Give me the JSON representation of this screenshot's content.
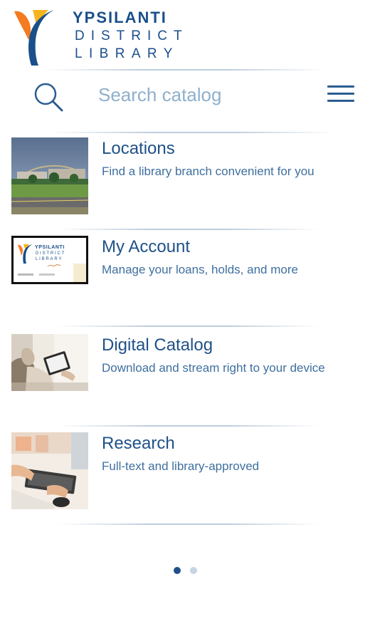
{
  "header": {
    "logo": {
      "line1": "YPSILANTI",
      "line2": "DISTRICT",
      "line3": "LIBRARY"
    }
  },
  "search": {
    "placeholder": "Search catalog"
  },
  "items": [
    {
      "title": "Locations",
      "subtitle": "Find a library branch convenient for you",
      "thumb_icon": "building-photo"
    },
    {
      "title": "My Account",
      "subtitle": "Manage your loans, holds, and more",
      "thumb_icon": "library-card"
    },
    {
      "title": "Digital Catalog",
      "subtitle": "Download and stream right to your device",
      "thumb_icon": "tablet-reader-photo"
    },
    {
      "title": "Research",
      "subtitle": "Full-text and library-approved",
      "thumb_icon": "keyboard-typing-photo"
    }
  ],
  "pager": {
    "pages": 2,
    "current": 1
  },
  "colors": {
    "brand_blue": "#1f5188",
    "logo_orange": "#f47b20",
    "logo_yellow": "#f7b41d",
    "logo_navy": "#1a4f8a"
  }
}
